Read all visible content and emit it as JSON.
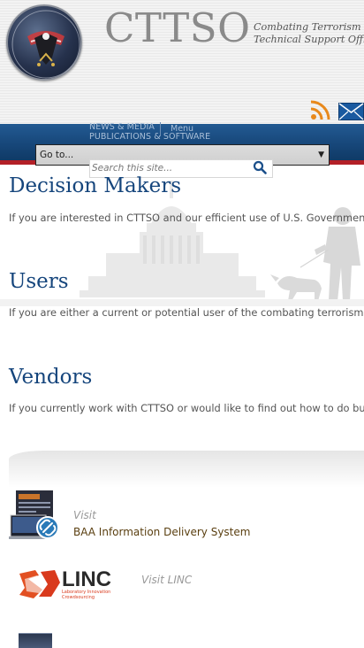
{
  "header": {
    "logo_text": "CTTSO",
    "tagline_line1": "Combating Terrorism",
    "tagline_line2": "Technical Support Office",
    "icons": [
      "seal-icon",
      "rss-icon",
      "mail-icon"
    ]
  },
  "nav": {
    "links": [
      "NEWS & MEDIA",
      "PUBLICATIONS & SOFTWARE"
    ],
    "menu_label": "Menu",
    "goto_label": "Go to...",
    "search_placeholder": "Search this site...",
    "colors": {
      "bar": "#1c4f86",
      "accent": "#b32027"
    }
  },
  "sections": [
    {
      "title": "Decision Makers",
      "text": "If you are interested in CTTSO and our efficient use of U.S. Government funds..."
    },
    {
      "title": "Users",
      "text": "If you are either a current or potential user of the combating terrorism..."
    },
    {
      "title": "Vendors",
      "text": "If you currently work with CTTSO or would like to find out how to do business..."
    }
  ],
  "links": {
    "baa_visit": "Visit",
    "baa_link": "BAA Information Delivery System",
    "linc_link": "Visit LINC",
    "linc_logo_text": "LINC",
    "linc_logo_sub1": "Laboratory Innovation",
    "linc_logo_sub2": "Crowdsourcing"
  },
  "colors": {
    "title": "#15457c",
    "link": "#5a3f10"
  }
}
